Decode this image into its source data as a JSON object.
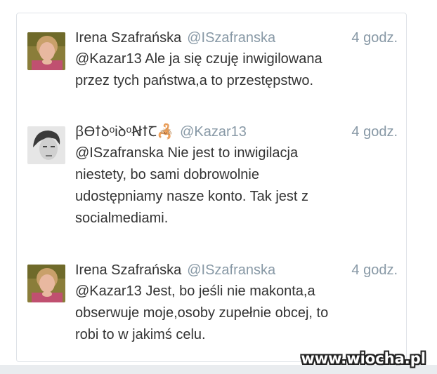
{
  "tweets": [
    {
      "name": "Irena Szafrańska",
      "handle": "@ISzafranska",
      "time": "4 godz.",
      "text": "@Kazar13 Ale ja się czuję inwigilowana\nprzez tych państwa,a to przestępstwo."
    },
    {
      "name": "ꞵϴꝉꝺᵒiꝺᵒꞤꝉꞆ",
      "name_emoji": "🦂",
      "handle": "@Kazar13",
      "time": "4 godz.",
      "text": "@ISzafranska Nie jest to inwigilacja\nniestety, bo sami dobrowolnie\nudostępniamy nasze konto. Tak jest z\nsocialmediami."
    },
    {
      "name": "Irena Szafrańska",
      "handle": "@ISzafranska",
      "time": "4 godz.",
      "text": "@Kazar13 Jest, bo jeśli nie makonta,a\nobserwuje moje,osoby zupełnie obcej, to\nrobi to w jakimś celu."
    }
  ],
  "watermark": "www.wiocha.pl"
}
